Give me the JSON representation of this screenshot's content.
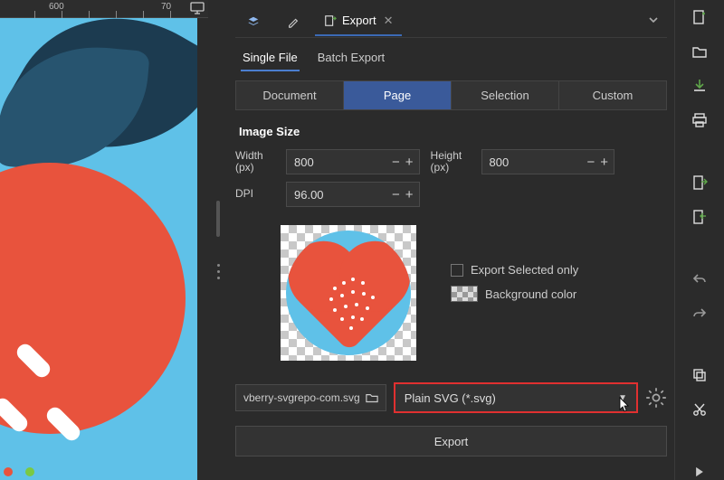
{
  "ruler": {
    "tick600": "600",
    "tick70": "70"
  },
  "panel": {
    "tab_label": "Export",
    "mode": {
      "single": "Single File",
      "batch": "Batch Export"
    },
    "source": {
      "document": "Document",
      "page": "Page",
      "selection": "Selection",
      "custom": "Custom"
    },
    "image_size_title": "Image Size",
    "width_label": "Width (px)",
    "height_label": "Height (px)",
    "dpi_label": "DPI",
    "width_value": "800",
    "height_value": "800",
    "dpi_value": "96.00",
    "export_selected_label": "Export Selected only",
    "background_label": "Background color",
    "filename": "vberry-svgrepo-com.svg",
    "format": "Plain SVG (*.svg)",
    "export_button": "Export"
  },
  "sidebar": {
    "items": [
      "new-document-icon",
      "open-icon",
      "import-icon",
      "print-icon",
      "export-page-icon",
      "import-page-icon",
      "undo-icon",
      "redo-icon",
      "copy-icon",
      "cut-icon",
      "expand-arrow-icon"
    ]
  }
}
